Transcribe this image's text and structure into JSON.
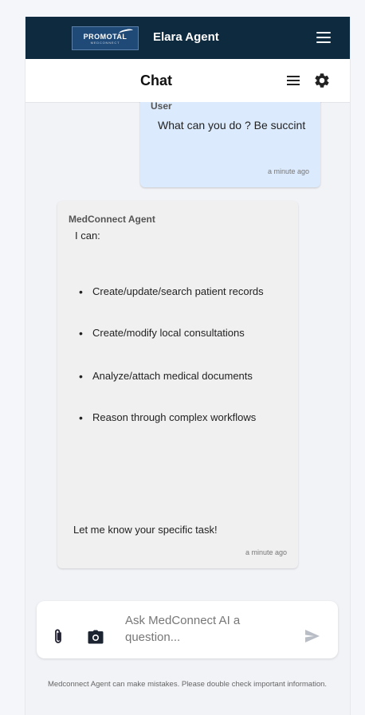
{
  "topbar": {
    "logo_text": "PROMOTAL",
    "logo_subtext": "MEDCONNECT",
    "app_title": "Elara Agent",
    "menu_icon": "hamburger-menu-icon"
  },
  "chat_header": {
    "title": "Chat",
    "list_icon": "list-icon",
    "settings_icon": "gear-icon"
  },
  "messages": {
    "user": {
      "sender": "User",
      "text": "What can you do ? Be succint",
      "time": "a minute ago"
    },
    "agent": {
      "sender": "MedConnect Agent",
      "intro": "I can:",
      "items": [
        "Create/update/search patient records",
        "Create/modify local consultations",
        "Analyze/attach medical documents",
        "Reason through complex workflows"
      ],
      "closing": "Let me know your specific task!",
      "time": "a minute ago"
    }
  },
  "composer": {
    "placeholder": "Ask MedConnect AI a question...",
    "attach_icon": "paperclip-icon",
    "camera_icon": "camera-icon",
    "send_icon": "send-icon"
  },
  "disclaimer": "Medconnect Agent can make mistakes. Please double check important information.",
  "colors": {
    "topbar": "#0e2a3f",
    "user_bubble": "#dbeafc",
    "agent_bubble": "#f0f0f1"
  }
}
